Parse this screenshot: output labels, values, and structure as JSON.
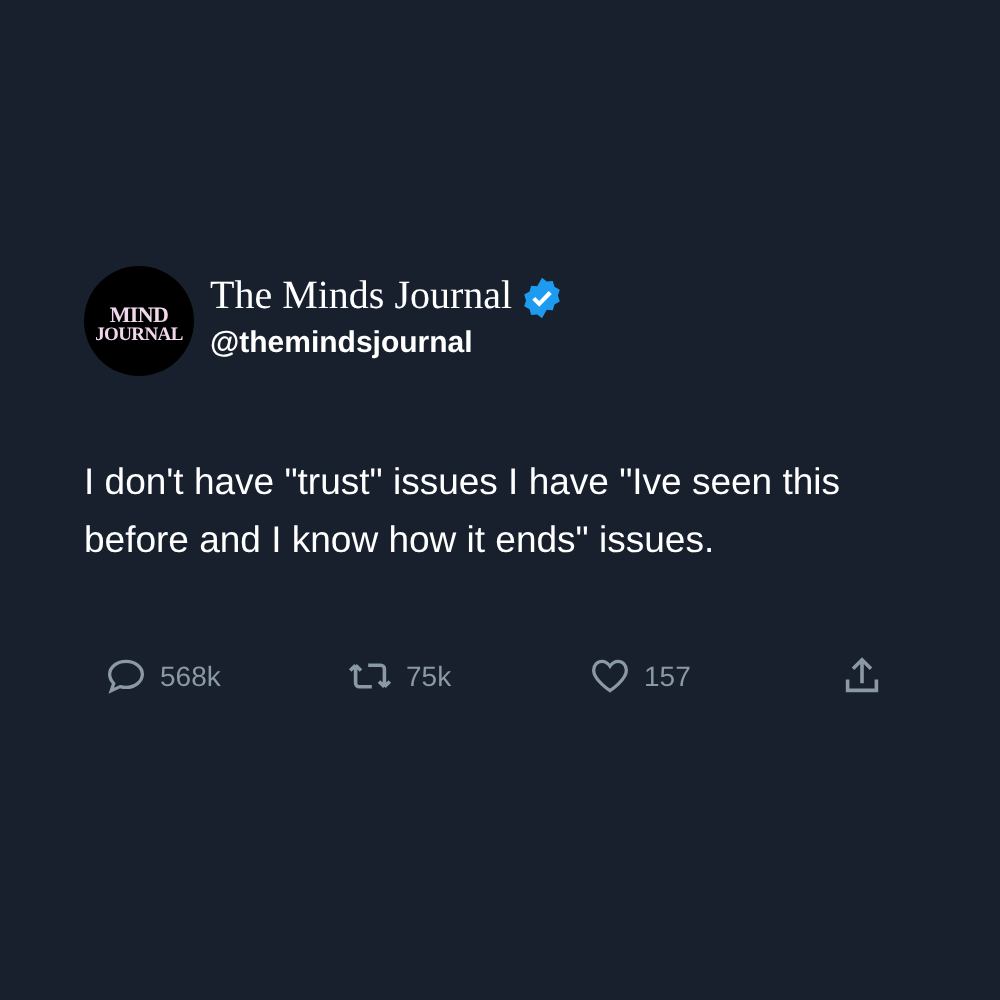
{
  "author": {
    "avatar_text": [
      "MIND",
      "JOURNAL"
    ],
    "name": "The Minds Journal",
    "verified": true,
    "handle": "@themindsjournal"
  },
  "text": "I don't have \"trust\" issues I have \"Ive seen this before and I know how it ends\" issues.",
  "actions": [
    {
      "kind": "reply",
      "count": "568k"
    },
    {
      "kind": "retweet",
      "count": "75k"
    },
    {
      "kind": "like",
      "count": "157"
    },
    {
      "kind": "share"
    }
  ]
}
